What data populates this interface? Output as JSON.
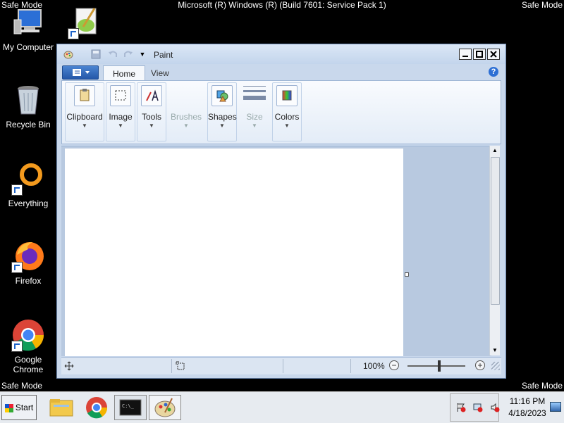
{
  "screen": {
    "safe_mode_label": "Safe Mode",
    "os_title": "Microsoft (R) Windows (R) (Build 7601: Service Pack 1)"
  },
  "desktop_icons": [
    {
      "label": "My Computer",
      "icon": "computer-icon"
    },
    {
      "label": "",
      "icon": "notepad-plus-plus-icon"
    },
    {
      "label": "Recycle Bin",
      "icon": "recycle-bin-icon"
    },
    {
      "label": "Everything",
      "icon": "everything-search-icon"
    },
    {
      "label": "Firefox",
      "icon": "firefox-icon"
    },
    {
      "label": "Google Chrome",
      "icon": "chrome-icon"
    }
  ],
  "paint": {
    "title": "Paint",
    "tabs": [
      {
        "label": "Home",
        "active": true
      },
      {
        "label": "View",
        "active": false
      }
    ],
    "ribbon_groups": [
      {
        "label": "Clipboard",
        "enabled": true
      },
      {
        "label": "Image",
        "enabled": true
      },
      {
        "label": "Tools",
        "enabled": true
      },
      {
        "label": "Brushes",
        "enabled": false
      },
      {
        "label": "Shapes",
        "enabled": true
      },
      {
        "label": "Size",
        "enabled": false
      },
      {
        "label": "Colors",
        "enabled": true
      }
    ],
    "status": {
      "zoom": "100%"
    },
    "accent_color": "#2d6fd4"
  },
  "taskbar": {
    "start_label": "Start",
    "pinned": [
      "file-explorer-icon",
      "chrome-icon",
      "command-prompt-icon",
      "paint-icon"
    ],
    "clock_time": "11:16 PM",
    "clock_date": "4/18/2023"
  }
}
